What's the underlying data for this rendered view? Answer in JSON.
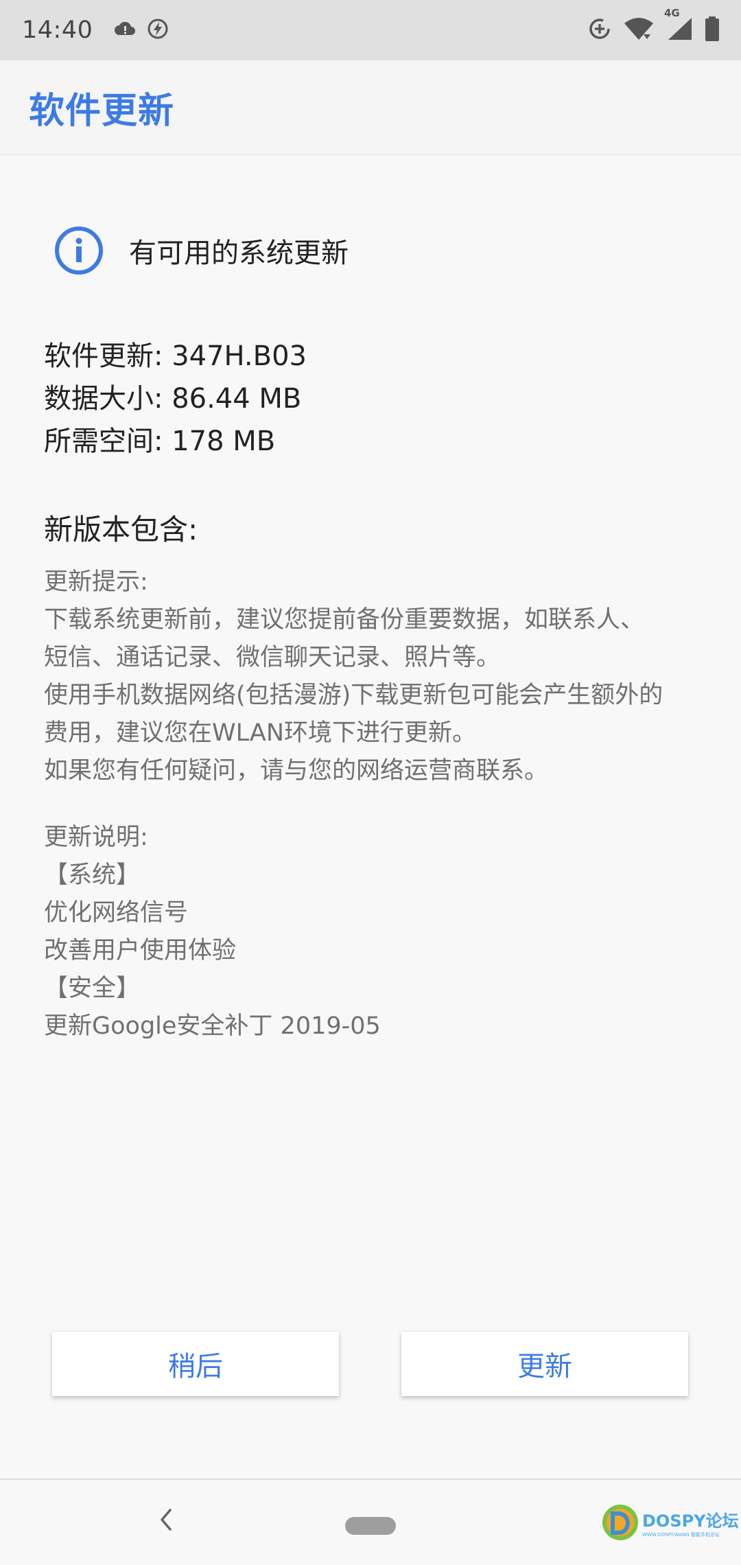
{
  "status_bar": {
    "time": "14:40",
    "network": "4G",
    "icons_left": [
      "cloud-warning-icon",
      "flash-icon"
    ],
    "icons_right": [
      "data-saver-icon",
      "wifi-icon",
      "signal-icon",
      "battery-icon"
    ]
  },
  "app_bar": {
    "title": "软件更新"
  },
  "notice": {
    "text": "有可用的系统更新"
  },
  "info": {
    "lines": [
      "软件更新: 347H.B03",
      "数据大小: 86.44 MB",
      "所需空间: 178 MB"
    ]
  },
  "section_title": "新版本包含:",
  "notes": {
    "tips": [
      "更新提示:",
      "下载系统更新前，建议您提前备份重要数据，如联系人、",
      "短信、通话记录、微信聊天记录、照片等。",
      "使用手机数据网络(包括漫游)下载更新包可能会产生额外的",
      "费用，建议您在WLAN环境下进行更新。",
      "如果您有任何疑问，请与您的网络运营商联系。"
    ],
    "changes": [
      "更新说明:",
      "【系统】",
      "优化网络信号",
      "改善用户使用体验",
      "【安全】",
      "更新Google安全补丁 2019-05"
    ]
  },
  "buttons": {
    "later": "稍后",
    "update": "更新"
  },
  "watermark": {
    "text": "DOSPY论坛",
    "sub": "WWW.DOSPY.WANG 智能手机论坛"
  },
  "colors": {
    "accent": "#3d7be4",
    "text_primary": "#222222",
    "text_secondary": "#707070"
  }
}
